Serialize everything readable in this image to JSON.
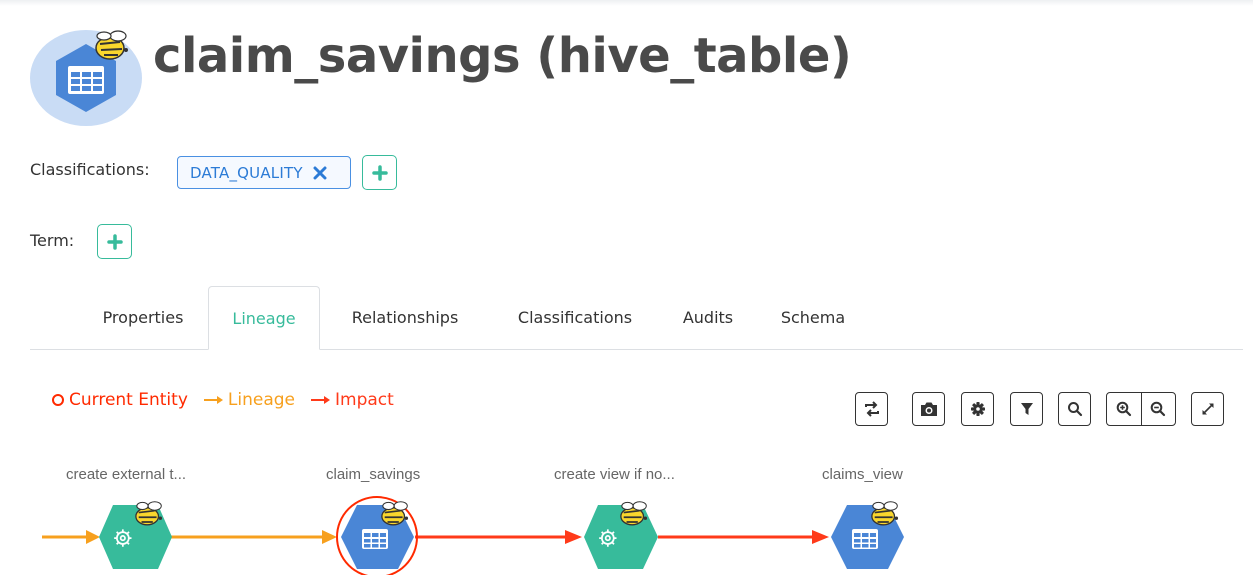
{
  "entity": {
    "title": "claim_savings (hive_table)",
    "icon": "hive-table-icon"
  },
  "classifications": {
    "label": "Classifications:",
    "tags": [
      {
        "text": "DATA_QUALITY",
        "remove_icon": "close-icon"
      }
    ],
    "add_icon": "plus-icon"
  },
  "term": {
    "label": "Term:",
    "add_icon": "plus-icon"
  },
  "tabs": [
    {
      "label": "Properties",
      "active": false
    },
    {
      "label": "Lineage",
      "active": true
    },
    {
      "label": "Relationships",
      "active": false
    },
    {
      "label": "Classifications",
      "active": false
    },
    {
      "label": "Audits",
      "active": false
    },
    {
      "label": "Schema",
      "active": false
    }
  ],
  "legend": {
    "current": "Current Entity",
    "lineage": "Lineage",
    "impact": "Impact"
  },
  "toolbar": {
    "icons": [
      "realign-icon",
      "camera-icon",
      "gear-icon",
      "filter-icon",
      "search-icon",
      "zoom-in-icon",
      "zoom-out-icon",
      "fullscreen-icon"
    ]
  },
  "lineage_nodes": [
    {
      "label": "create external t...",
      "type": "process"
    },
    {
      "label": "claim_savings",
      "type": "table",
      "current": true
    },
    {
      "label": "create view if no...",
      "type": "process"
    },
    {
      "label": "claims_view",
      "type": "table"
    }
  ],
  "colors": {
    "accent": "#37bb9b",
    "tag_blue": "#4a90e2",
    "lineage": "#f7a01e",
    "impact": "#ff3a1a",
    "current": "#ff2a00",
    "table_node": "#4a86d6",
    "process_node": "#37bb9b",
    "hive_yellow": "#f9d62d"
  }
}
